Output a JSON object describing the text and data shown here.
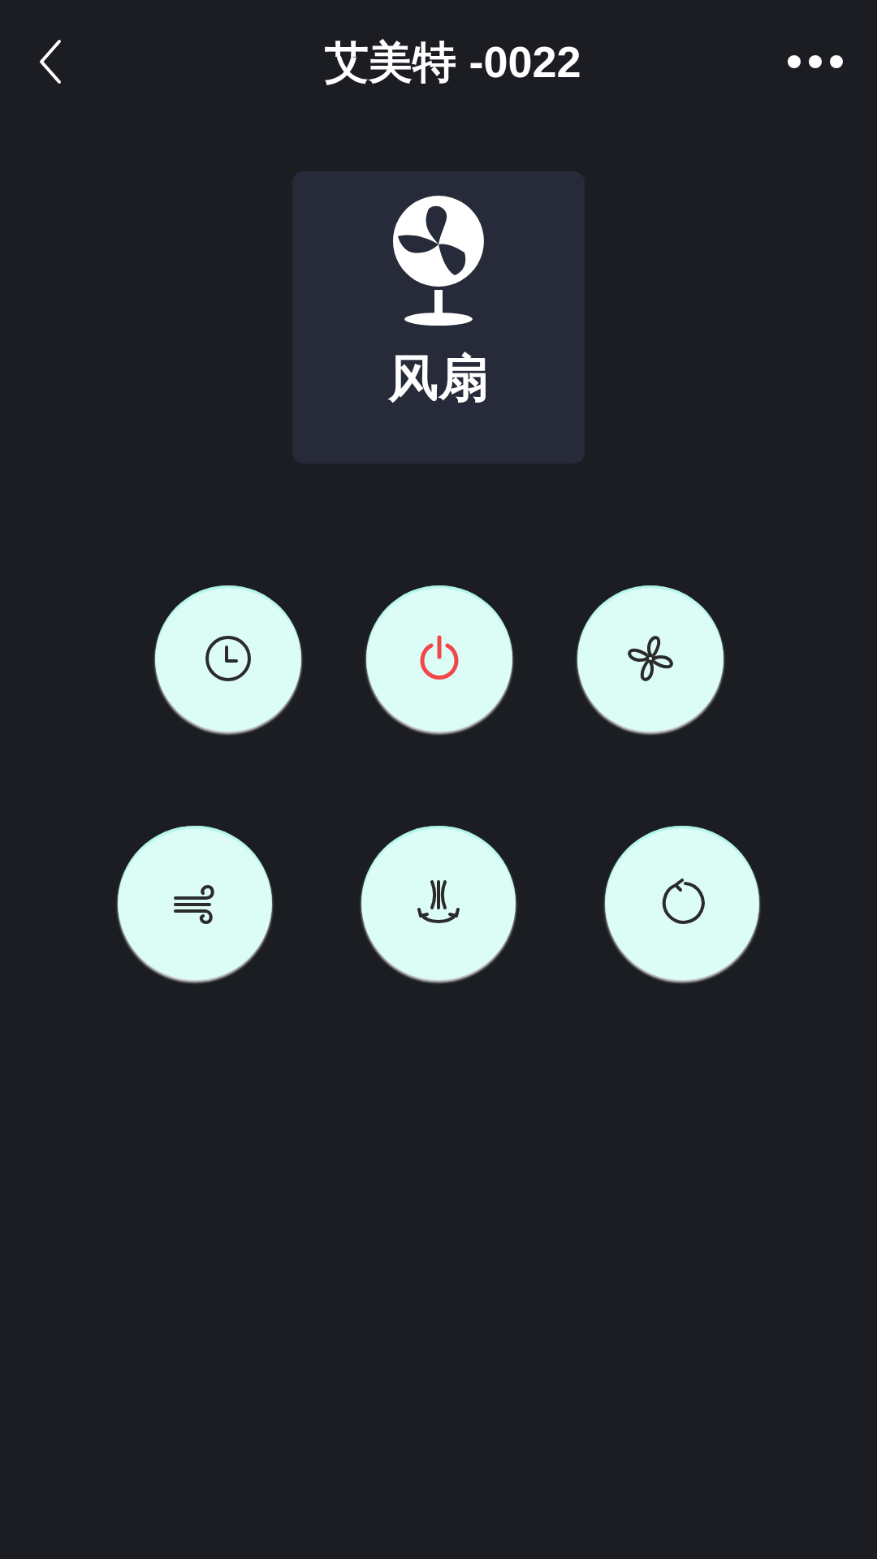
{
  "header": {
    "title": "艾美特 -0022"
  },
  "device_card": {
    "label": "风扇"
  },
  "button_rows": [
    [
      {
        "kind": "timer",
        "color": "#2b2b2b"
      },
      {
        "kind": "power",
        "color": "#f2474a"
      },
      {
        "kind": "fan",
        "color": "#2b2b2b"
      }
    ],
    [
      {
        "kind": "wind",
        "color": "#2b2b2b"
      },
      {
        "kind": "swing",
        "color": "#2b2b2b"
      },
      {
        "kind": "rotate",
        "color": "#2b2b2b"
      }
    ]
  ]
}
